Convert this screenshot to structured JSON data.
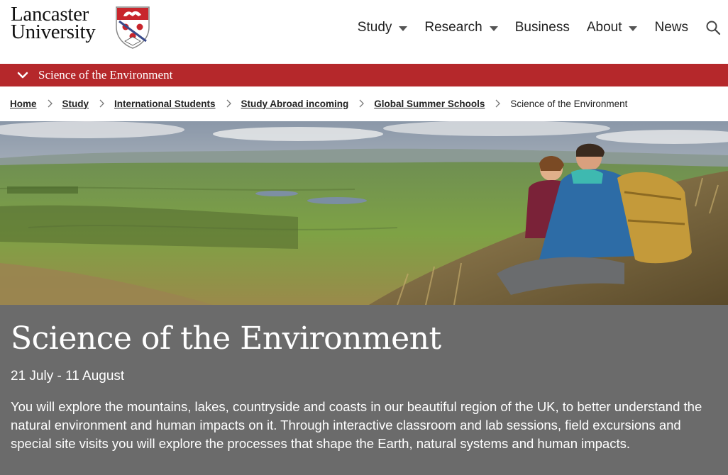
{
  "logo": {
    "line1": "Lancaster",
    "line2": "University",
    "icon": "university-shield-icon"
  },
  "nav": {
    "items": [
      {
        "label": "Study",
        "has_dropdown": true
      },
      {
        "label": "Research",
        "has_dropdown": true
      },
      {
        "label": "Business",
        "has_dropdown": false
      },
      {
        "label": "About",
        "has_dropdown": true
      },
      {
        "label": "News",
        "has_dropdown": false
      }
    ],
    "search_icon": "search-icon"
  },
  "section_bar": {
    "title": "Science of the Environment",
    "icon": "chevron-down-icon",
    "color": "#b5282b"
  },
  "breadcrumb": {
    "items": [
      "Home",
      "Study",
      "International Students",
      "Study Abroad incoming",
      "Global Summer Schools"
    ],
    "current": "Science of the Environment"
  },
  "hero": {
    "image": "landscape-hikers-photo"
  },
  "panel": {
    "title": "Science of the Environment",
    "dates": "21 July - 11 August",
    "description": "You will explore the mountains, lakes, countryside and coasts in our beautiful region of the UK, to better understand the natural environment and human impacts on it. Through interactive classroom and lab sessions, field excursions and special site visits you will explore the processes that shape the Earth, natural systems and human impacts.",
    "background": "#6b6b6b"
  }
}
